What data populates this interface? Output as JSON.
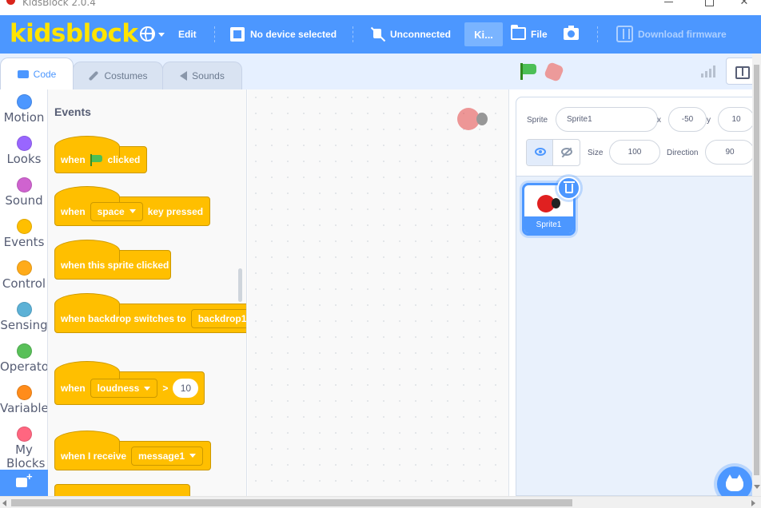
{
  "window": {
    "title": "KidsBlock 2.0.4"
  },
  "menubar": {
    "logo": "kidsblock",
    "edit": "Edit",
    "device": "No device selected",
    "connection": "Unconnected",
    "ki": "Ki...",
    "file": "File",
    "download_firmware": "Download firmware"
  },
  "tabs": {
    "code": "Code",
    "costumes": "Costumes",
    "sounds": "Sounds"
  },
  "categories": [
    {
      "label": "Motion",
      "color": "#4c97ff"
    },
    {
      "label": "Looks",
      "color": "#9966ff"
    },
    {
      "label": "Sound",
      "color": "#cf63cf"
    },
    {
      "label": "Events",
      "color": "#ffbf00"
    },
    {
      "label": "Control",
      "color": "#ffab19"
    },
    {
      "label": "Sensing",
      "color": "#5cb1d6"
    },
    {
      "label": "Operators",
      "color": "#59c059"
    },
    {
      "label": "Variables",
      "color": "#ff8c1a"
    },
    {
      "label": "My Blocks",
      "color": "#ff6680"
    }
  ],
  "palette": {
    "title": "Events",
    "blocks": {
      "flag": {
        "when": "when",
        "clicked": "clicked"
      },
      "key": {
        "when": "when",
        "key": "space",
        "pressed": "key pressed"
      },
      "sprite": {
        "text": "when this sprite clicked"
      },
      "backdrop": {
        "text": "when backdrop switches to",
        "value": "backdrop1"
      },
      "loudness": {
        "when": "when",
        "option": "loudness",
        "op": ">",
        "value": "10"
      },
      "receive": {
        "text": "when I receive",
        "value": "message1"
      }
    }
  },
  "sprite_info": {
    "sprite_label": "Sprite",
    "sprite_name": "Sprite1",
    "x_label": "x",
    "x": "-50",
    "y_label": "y",
    "y": "10",
    "size_label": "Size",
    "size": "100",
    "direction_label": "Direction",
    "direction": "90"
  },
  "sprites": [
    {
      "name": "Sprite1"
    }
  ],
  "colors": {
    "accent": "#4c97ff",
    "logo": "#ffe400",
    "events": "#ffbf00"
  }
}
